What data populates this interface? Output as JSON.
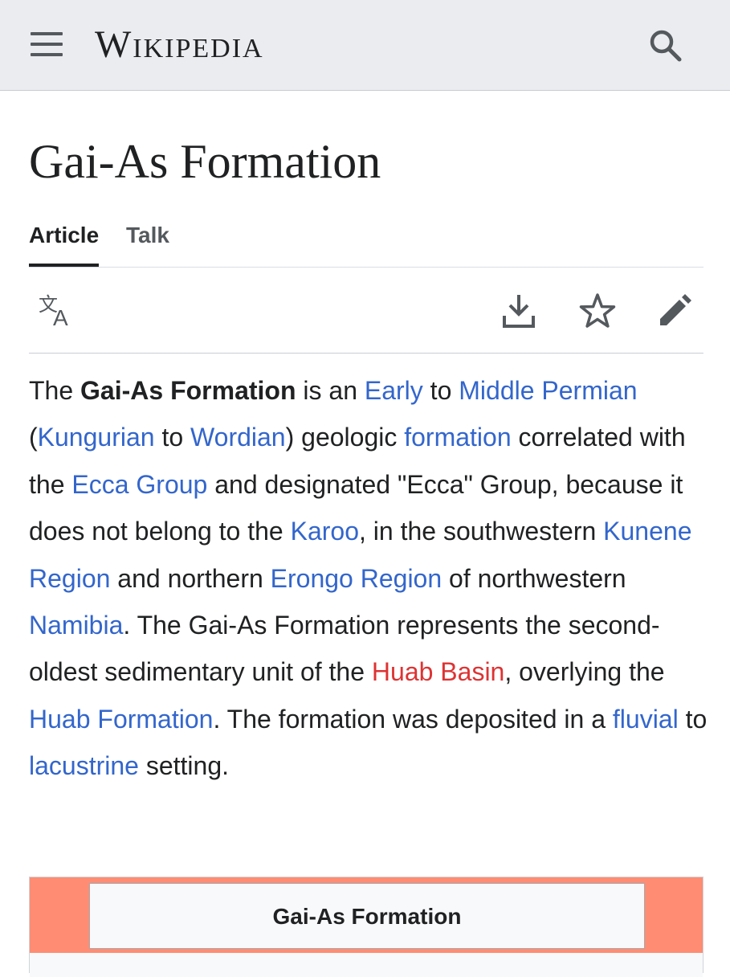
{
  "header": {
    "menu_icon": "hamburger-menu-icon",
    "wordmark": "Wikipedia",
    "search_icon": "search-icon"
  },
  "page": {
    "title": "Gai-As Formation"
  },
  "tabs": [
    {
      "label": "Article",
      "active": true
    },
    {
      "label": "Talk",
      "active": false
    }
  ],
  "actions": {
    "language_icon": "translate-icon",
    "download_icon": "download-icon",
    "watch_icon": "star-icon",
    "edit_icon": "pencil-icon"
  },
  "colors": {
    "link": "#3366cc",
    "new_link": "#dd3333",
    "infobox_header": "#ff8c73",
    "header_bg": "#eaecf0"
  },
  "lead": {
    "t1": "The ",
    "bold": "Gai-As Formation",
    "t2": " is an ",
    "l_early": "Early",
    "t3": " to ",
    "l_middle_permian": "Middle Permian",
    "t4": " (",
    "l_kungurian": "Kungurian",
    "t5": " to ",
    "l_wordian": "Wordian",
    "t6": ") geologic ",
    "l_formation": "formation",
    "t7": " correlated with the ",
    "l_ecca_group": "Ecca Group",
    "t8": " and designated \"Ecca\" Group, because it does not belong to the ",
    "l_karoo": "Karoo",
    "t9": ", in the southwestern ",
    "l_kunene_region": "Kunene Region",
    "t10": " and northern ",
    "l_erongo_region": "Erongo Region",
    "t11": " of northwestern ",
    "l_namibia": "Namibia",
    "t12": ". The Gai-As Formation represents the second-oldest sedimentary unit of the ",
    "l_huab_basin": "Huab Basin",
    "t13": ", overlying the ",
    "l_huab_formation": "Huab Formation",
    "t14": ". The formation was deposited in a ",
    "l_fluvial": "fluvial",
    "t15": " to ",
    "l_lacustrine": "lacustrine",
    "t16": " setting."
  },
  "infobox": {
    "title": "Gai-As Formation"
  }
}
